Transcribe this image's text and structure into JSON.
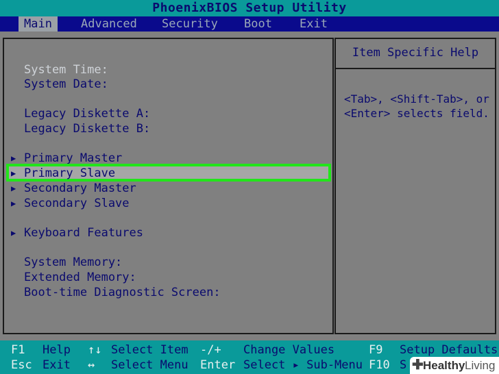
{
  "title": "PhoenixBIOS Setup Utility",
  "menu": [
    {
      "label": "Main",
      "active": true
    },
    {
      "label": "Advanced"
    },
    {
      "label": "Security"
    },
    {
      "label": "Boot"
    },
    {
      "label": "Exit"
    }
  ],
  "fields": {
    "system_time": "System Time:",
    "system_date": "System Date:",
    "legacy_a": "Legacy Diskette A:",
    "legacy_b": "Legacy Diskette B:",
    "primary_master": "Primary Master",
    "primary_slave": "Primary Slave",
    "secondary_master": "Secondary Master",
    "secondary_slave": "Secondary Slave",
    "keyboard_features": "Keyboard Features",
    "system_memory": "System Memory:",
    "extended_memory": "Extended Memory:",
    "boot_diag": "Boot-time Diagnostic Screen:"
  },
  "help": {
    "title": "Item Specific Help",
    "line1": "<Tab>, <Shift-Tab>, or",
    "line2": "<Enter> selects field."
  },
  "status": {
    "f1_key": "F1",
    "f1_desc": "Help",
    "updown_key": "↑↓",
    "updown_desc": "Select Item",
    "pm_key": "-/+",
    "pm_desc": "Change Values",
    "f9_key": "F9",
    "f9_desc": "Setup Defaults",
    "esc_key": "Esc",
    "esc_desc": "Exit",
    "lr_key": "↔",
    "lr_desc": "Select Menu",
    "enter_key": "Enter",
    "enter_desc": "Select ▸ Sub-Menu",
    "f10_key": "F10",
    "f10_desc": "S"
  },
  "watermark": {
    "brand1": "Healthy",
    "brand2": "Living"
  },
  "colors": {
    "accent_highlight": "#22e51a",
    "title_bg": "#0a9a9a",
    "menu_bg": "#0a0a8c"
  }
}
